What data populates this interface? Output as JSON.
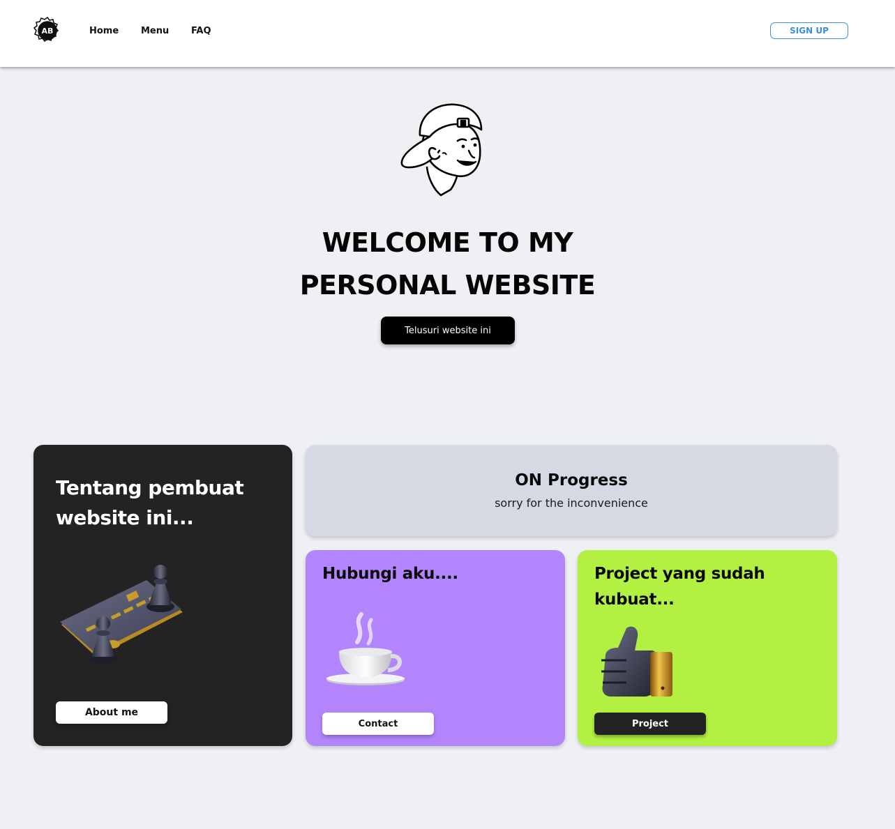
{
  "nav": {
    "logo_icon": "gear-badge-logo-icon",
    "links": [
      "Home",
      "Menu",
      "FAQ"
    ],
    "signup_label": "SIGN UP"
  },
  "hero": {
    "avatar_icon": "avatar-cap-illustration",
    "title_line1": "WELCOME TO MY",
    "title_line2": "PERSONAL WEBSITE",
    "cta_label": "Telusuri website ini"
  },
  "cards": {
    "about": {
      "title": "Tentang pembuat website ini...",
      "image_icon": "chess-card-illustration",
      "button_label": "About me",
      "color": "#232323"
    },
    "progress": {
      "title": "ON Progress",
      "subtitle": "sorry for the inconvenience",
      "color": "#d5d9e4"
    },
    "contact": {
      "title": "Hubungi aku....",
      "image_icon": "coffee-cup-illustration",
      "button_label": "Contact",
      "color": "#b285fc"
    },
    "project": {
      "title": "Project yang sudah kubuat...",
      "image_icon": "thumbs-up-illustration",
      "button_label": "Project",
      "color": "#b2f041"
    }
  },
  "colors": {
    "background": "#eef0f4",
    "accent": "#3a8fd9"
  }
}
